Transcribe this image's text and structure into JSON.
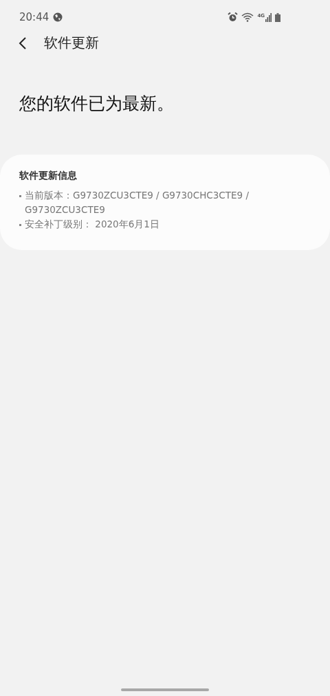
{
  "status_bar": {
    "time": "20:44",
    "signal_label": "4G"
  },
  "header": {
    "title": "软件更新"
  },
  "headline": "您的软件已为最新。",
  "info_card": {
    "title": "软件更新信息",
    "items": [
      {
        "text": "当前版本：G9730ZCU3CTE9 / G9730CHC3CTE9 / G9730ZCU3CTE9"
      },
      {
        "text": "安全补丁级别： 2020年6月1日"
      }
    ]
  }
}
